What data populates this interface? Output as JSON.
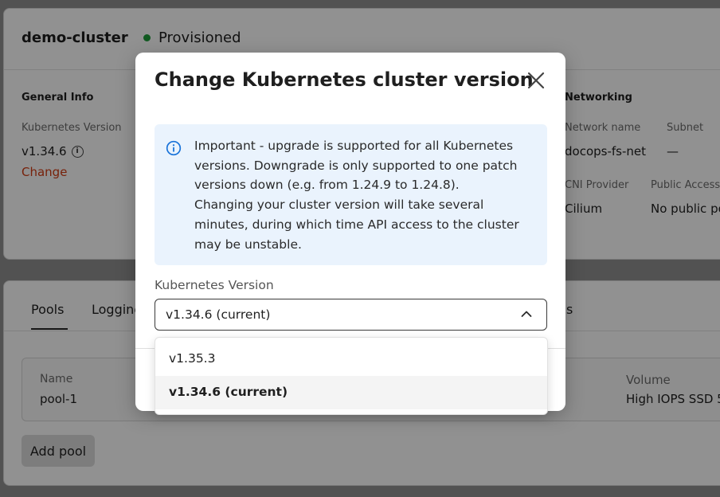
{
  "cluster": {
    "name": "demo-cluster",
    "status": "Provisioned",
    "status_color": "#1e9e3a"
  },
  "general_info": {
    "title": "General Info",
    "k8s_version_label": "Kubernetes Version",
    "k8s_version_value": "v1.34.6",
    "change_link": "Change"
  },
  "networking": {
    "title": "Networking",
    "network_name_label": "Network name",
    "network_name_value": "docops-fs-net",
    "subnet_label": "Subnet",
    "subnet_value": "—",
    "cni_label": "CNI Provider",
    "cni_value": "Cilium",
    "public_access_label": "Public Access",
    "public_access_value": "No public po"
  },
  "tabs": [
    {
      "label": "Pools",
      "active": true
    },
    {
      "label": "Logging",
      "active": false
    },
    {
      "label": "s",
      "active": false
    }
  ],
  "pools": {
    "row": {
      "name_label": "Name",
      "name_value": "pool-1",
      "volume_label": "Volume",
      "volume_value": "High IOPS SSD 5"
    },
    "add_button": "Add pool"
  },
  "modal": {
    "title": "Change Kubernetes cluster version",
    "info_lines": [
      "Important - upgrade is supported for all Kubernetes versions. Downgrade is only supported to one patch versions down (e.g. from 1.24.9 to 1.24.8).",
      "Changing your cluster version will take several minutes, during which time API access to the cluster may be unstable."
    ],
    "field_label": "Kubernetes Version",
    "selected_value": "v1.34.6 (current)",
    "options": [
      "v1.35.3",
      "v1.34.6 (current)"
    ],
    "info_bg": "#eaf3fd",
    "accent": "#1a73d9"
  }
}
